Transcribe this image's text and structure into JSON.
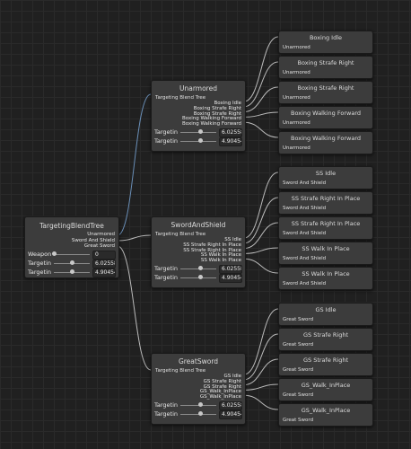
{
  "root": {
    "title": "TargetingBlendTree",
    "outputs": [
      "Unarmored",
      "Sword And Shield",
      "Great Sword"
    ],
    "params": [
      {
        "label": "Weapon",
        "value": "0"
      },
      {
        "label": "Targetin",
        "value": "6.02558"
      },
      {
        "label": "Targetin",
        "value": "4.90454"
      }
    ]
  },
  "subtrees": [
    {
      "title": "Unarmored",
      "blend_label": "Targeting Blend Tree",
      "outputs": [
        "Boxing Idle",
        "Boxing Strafe Right",
        "Boxing Strafe Right",
        "Boxing Walking Forward",
        "Boxing Walking Forward"
      ],
      "params": [
        {
          "label": "Targetin",
          "value": "6.02558"
        },
        {
          "label": "Targetin",
          "value": "4.90454"
        }
      ],
      "clips": [
        {
          "title": "Boxing Idle",
          "sub": "Unarmored"
        },
        {
          "title": "Boxing Strafe Right",
          "sub": "Unarmored"
        },
        {
          "title": "Boxing Strafe Right",
          "sub": "Unarmored"
        },
        {
          "title": "Boxing Walking Forward",
          "sub": "Unarmored"
        },
        {
          "title": "Boxing Walking Forward",
          "sub": "Unarmored"
        }
      ]
    },
    {
      "title": "SwordAndShield",
      "blend_label": "Targeting Blend Tree",
      "outputs": [
        "SS Idle",
        "SS Strafe Right In Place",
        "SS Strafe Right In Place",
        "SS Walk In Place",
        "SS Walk In Place"
      ],
      "params": [
        {
          "label": "Targetin",
          "value": "6.02558"
        },
        {
          "label": "Targetin",
          "value": "4.90454"
        }
      ],
      "clips": [
        {
          "title": "SS Idle",
          "sub": "Sword And Shield"
        },
        {
          "title": "SS Strafe Right In Place",
          "sub": "Sword And Shield"
        },
        {
          "title": "SS Strafe Right In Place",
          "sub": "Sword And Shield"
        },
        {
          "title": "SS Walk In Place",
          "sub": "Sword And Shield"
        },
        {
          "title": "SS Walk In Place",
          "sub": "Sword And Shield"
        }
      ]
    },
    {
      "title": "GreatSword",
      "blend_label": "Targeting Blend Tree",
      "outputs": [
        "GS Idle",
        "GS Strafe Right",
        "GS Strafe Right",
        "GS_Walk_InPlace",
        "GS_Walk_InPlace"
      ],
      "params": [
        {
          "label": "Targetin",
          "value": "6.02558"
        },
        {
          "label": "Targetin",
          "value": "4.90454"
        }
      ],
      "clips": [
        {
          "title": "GS Idle",
          "sub": "Great Sword"
        },
        {
          "title": "GS Strafe Right",
          "sub": "Great Sword"
        },
        {
          "title": "GS Strafe Right",
          "sub": "Great Sword"
        },
        {
          "title": "GS_Walk_InPlace",
          "sub": "Great Sword"
        },
        {
          "title": "GS_Walk_InPlace",
          "sub": "Great Sword"
        }
      ]
    }
  ]
}
